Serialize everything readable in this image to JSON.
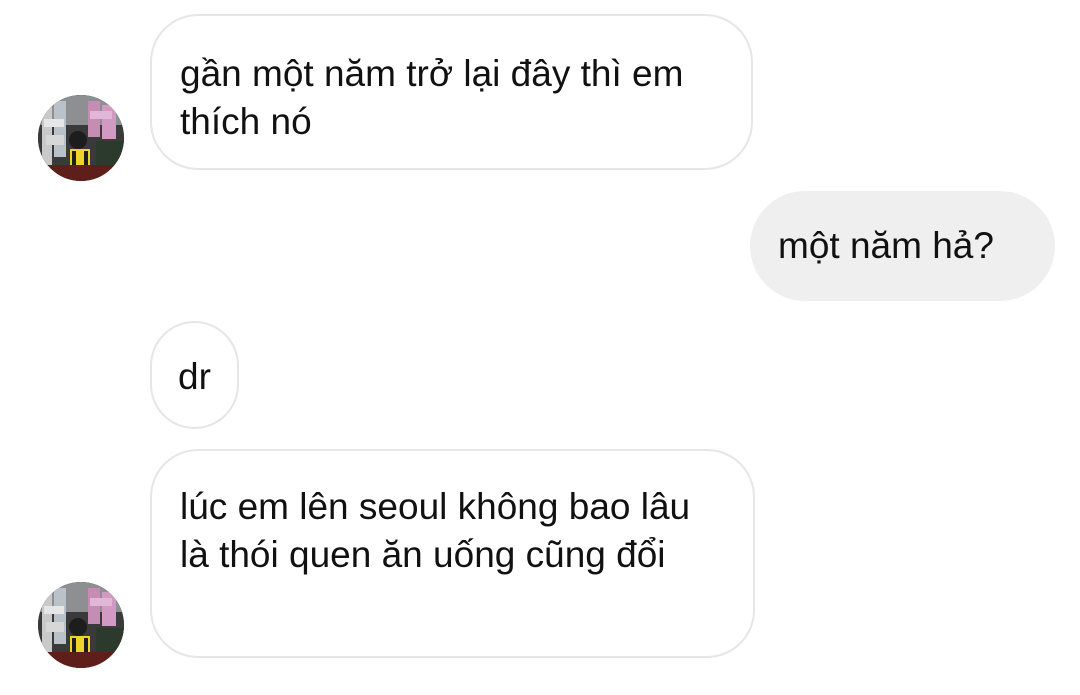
{
  "messages": [
    {
      "direction": "incoming",
      "text": "gần một năm trở lại đây thì em thích nó"
    },
    {
      "direction": "outgoing",
      "text": "một năm hả?"
    },
    {
      "direction": "incoming",
      "text": "dr"
    },
    {
      "direction": "incoming",
      "text": "lúc em lên seoul không bao lâu là thói quen ăn uống cũng đổi"
    }
  ],
  "colors": {
    "incoming_bubble_bg": "#ffffff",
    "incoming_bubble_border": "#e6e6e6",
    "outgoing_bubble_bg": "#efefef",
    "text": "#111111"
  }
}
